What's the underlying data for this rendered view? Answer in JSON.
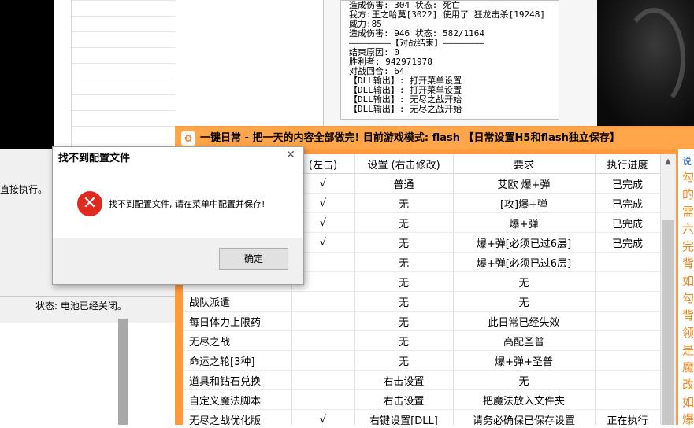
{
  "log": {
    "lines": [
      "造成伤害: 304 状态: 死亡",
      "我方:王之哈莫[3022] 使用了 狂龙击杀[19248]",
      "威力:85",
      "造成伤害: 946 状态: 582/1164",
      "————————【对战结束】————————",
      "结束原因: 0",
      "胜利者: 942971978",
      "对战回合: 64",
      "【DLL输出】: 打开菜单设置",
      "【DLL输出】: 打开菜单设置",
      "【DLL输出】: 无尽之战开始",
      "【DLL输出】: 无尽之战开始"
    ]
  },
  "status_window": {
    "partial_text": "直接执行。",
    "status_bar": "状态: 电池已经关闭。"
  },
  "main_window": {
    "title": "一键日常 - 把一天的内容全部做完! 目前游戏模式: flash 【日常设置H5和flash独立保存】",
    "icon": "gear-icon",
    "columns": [
      "(左击)",
      "设置 (右击修改)",
      "要求",
      "执行进度"
    ],
    "rows": [
      {
        "name": "",
        "check": "√",
        "setting": "普通",
        "req": "艾欧 爆+弹",
        "progress": "已完成"
      },
      {
        "name": "",
        "check": "√",
        "setting": "无",
        "req": "[攻]爆+弹",
        "progress": "已完成"
      },
      {
        "name": "",
        "check": "√",
        "setting": "无",
        "req": "爆+弹",
        "progress": "已完成"
      },
      {
        "name": "",
        "check": "√",
        "setting": "无",
        "req": "爆+弹[必须已过6层]",
        "progress": "已完成"
      },
      {
        "name": "",
        "check": "",
        "setting": "无",
        "req": "爆+弹[必须已过6层]",
        "progress": ""
      },
      {
        "name": "",
        "check": "",
        "setting": "无",
        "req": "无",
        "progress": ""
      },
      {
        "name": "战队派遣",
        "check": "",
        "setting": "无",
        "req": "无",
        "progress": ""
      },
      {
        "name": "每日体力上限药",
        "check": "",
        "setting": "无",
        "req": "此日常已经失效",
        "progress": ""
      },
      {
        "name": "无尽之战",
        "check": "",
        "setting": "无",
        "req": "高配圣普",
        "progress": ""
      },
      {
        "name": "命运之轮[3种]",
        "check": "",
        "setting": "无",
        "req": "爆+弹+圣普",
        "progress": ""
      },
      {
        "name": "道具和钻石兑换",
        "check": "",
        "setting": "右击设置",
        "req": "无",
        "progress": ""
      },
      {
        "name": "自定义魔法脚本",
        "check": "",
        "setting": "右击设置",
        "req": "把魔法放入文件夹",
        "progress": ""
      },
      {
        "name": "无尽之战优化版",
        "check": "√",
        "setting": "右键设置[DLL]",
        "req": "请务必确保已保存设置",
        "progress": "正在执行"
      }
    ],
    "right_panel_chars": [
      "说",
      "勾",
      "的",
      "需",
      "六",
      "完",
      "背",
      "如",
      "勾",
      "背",
      "领",
      "是",
      "魔",
      "改",
      "如",
      "爆"
    ]
  },
  "dialog": {
    "title": "找不到配置文件",
    "message": "找不到配置文件, 请在菜单中配置并保存!",
    "ok_label": "确定",
    "close_glyph": "✕",
    "icon": "error-icon"
  }
}
